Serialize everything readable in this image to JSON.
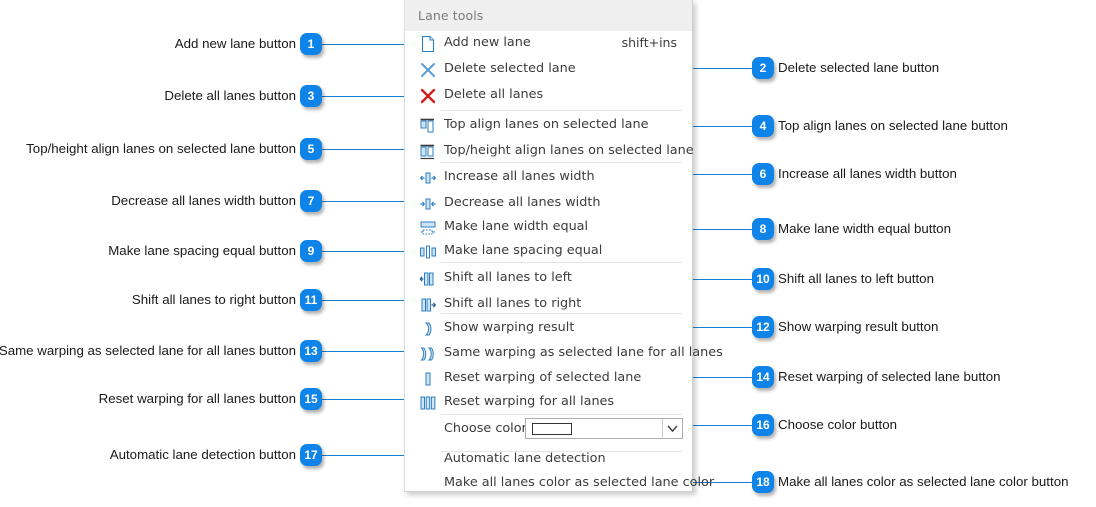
{
  "panel": {
    "title": "Lane tools",
    "items": [
      {
        "icon": "new-page-icon",
        "label": "Add new lane",
        "shortcut": "shift+ins"
      },
      {
        "icon": "delete-selected-lane-icon",
        "label": "Delete selected lane",
        "shortcut": ""
      },
      {
        "icon": "delete-all-lanes-icon",
        "label": "Delete all lanes",
        "shortcut": ""
      },
      {
        "icon": "top-align-icon",
        "label": "Top align  lanes on selected lane",
        "shortcut": ""
      },
      {
        "icon": "top-height-align-icon",
        "label": "Top/height align lanes on selected lane",
        "shortcut": ""
      },
      {
        "icon": "increase-width-icon",
        "label": "Increase all lanes width",
        "shortcut": ""
      },
      {
        "icon": "decrease-width-icon",
        "label": "Decrease all lanes width",
        "shortcut": ""
      },
      {
        "icon": "equal-width-icon",
        "label": "Make lane width equal",
        "shortcut": ""
      },
      {
        "icon": "equal-spacing-icon",
        "label": "Make lane spacing equal",
        "shortcut": ""
      },
      {
        "icon": "shift-left-icon",
        "label": "Shift all lanes to left",
        "shortcut": ""
      },
      {
        "icon": "shift-right-icon",
        "label": "Shift all lanes to right",
        "shortcut": ""
      },
      {
        "icon": "show-warping-icon",
        "label": "Show warping result",
        "shortcut": ""
      },
      {
        "icon": "same-warping-icon",
        "label": "Same warping as selected lane for all lanes",
        "shortcut": ""
      },
      {
        "icon": "reset-warping-icon",
        "label": "Reset warping of selected lane",
        "shortcut": ""
      },
      {
        "icon": "reset-warping-all-icon",
        "label": "Reset warping for all lanes",
        "shortcut": ""
      }
    ],
    "color_row": {
      "label": "Choose color",
      "swatch_color": "#ffffff",
      "arrow_icon": "chevron-down-icon"
    },
    "footer_items": [
      {
        "label": "Automatic lane detection"
      },
      {
        "label": "Make all lanes color as selected lane color"
      }
    ]
  },
  "accent_color": "#0f84e8",
  "leader_color": "#1a7fd4",
  "callouts": {
    "left": [
      {
        "number": "1",
        "label": "Add new lane button"
      },
      {
        "number": "3",
        "label": "Delete all lanes button"
      },
      {
        "number": "5",
        "label": "Top/height align lanes on selected lane button"
      },
      {
        "number": "7",
        "label": "Decrease all lanes width button"
      },
      {
        "number": "9",
        "label": "Make lane spacing equal button"
      },
      {
        "number": "11",
        "label": "Shift all lanes to right button"
      },
      {
        "number": "13",
        "label": "Same warping as selected lane for all lanes button"
      },
      {
        "number": "15",
        "label": "Reset warping for all lanes button"
      },
      {
        "number": "17",
        "label": "Automatic lane detection button"
      }
    ],
    "right": [
      {
        "number": "2",
        "label": "Delete selected lane button"
      },
      {
        "number": "4",
        "label": "Top align  lanes on selected lane button"
      },
      {
        "number": "6",
        "label": "Increase all lanes width button"
      },
      {
        "number": "8",
        "label": "Make lane width equal button"
      },
      {
        "number": "10",
        "label": "Shift all lanes to left button"
      },
      {
        "number": "12",
        "label": "Show warping result button"
      },
      {
        "number": "14",
        "label": "Reset warping of selected lane button"
      },
      {
        "number": "16",
        "label": "Choose color button"
      },
      {
        "number": "18",
        "label": "Make all lanes color as selected lane color button"
      }
    ]
  }
}
